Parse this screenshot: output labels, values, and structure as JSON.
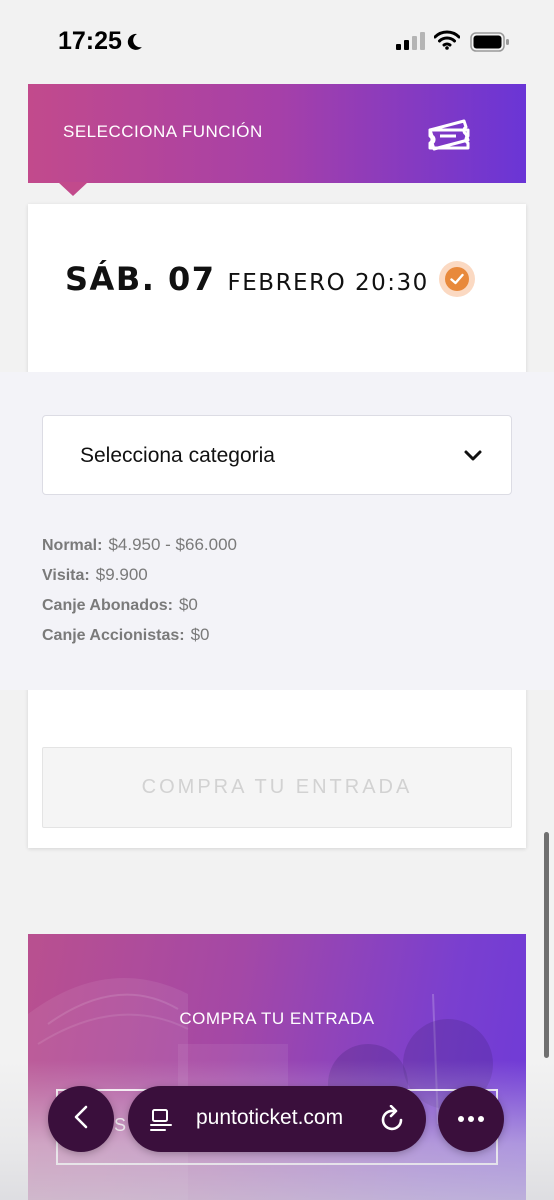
{
  "status_bar": {
    "time": "17:25"
  },
  "function_header": {
    "title": "SELECCIONA FUNCIÓN"
  },
  "show": {
    "day": "SÁB. 07",
    "rest": "FEBRERO 20:30"
  },
  "category": {
    "select_label": "Selecciona categoria",
    "prices": [
      {
        "label": "Normal:",
        "value": "$4.950 - $66.000"
      },
      {
        "label": "Visita:",
        "value": "$9.900"
      },
      {
        "label": "Canje Abonados:",
        "value": "$0"
      },
      {
        "label": "Canje Accionistas:",
        "value": "$0"
      }
    ]
  },
  "buy": {
    "label": "COMPRA TU ENTRADA"
  },
  "promo": {
    "title": "COMPRA TU ENTRADA",
    "box_text": "SE"
  },
  "browser": {
    "url": "puntoticket.com"
  },
  "colors": {
    "gradient_start": "#c24a8c",
    "gradient_end": "#6a35d6",
    "check_accent": "#e8893c",
    "toolbar_bg": "#3a0f3c"
  },
  "icons": [
    "moon-icon",
    "signal-icon",
    "wifi-icon",
    "battery-icon",
    "ticket-icon",
    "check-icon",
    "chevron-down-icon",
    "back-icon",
    "reader-icon",
    "reload-icon",
    "more-icon"
  ]
}
